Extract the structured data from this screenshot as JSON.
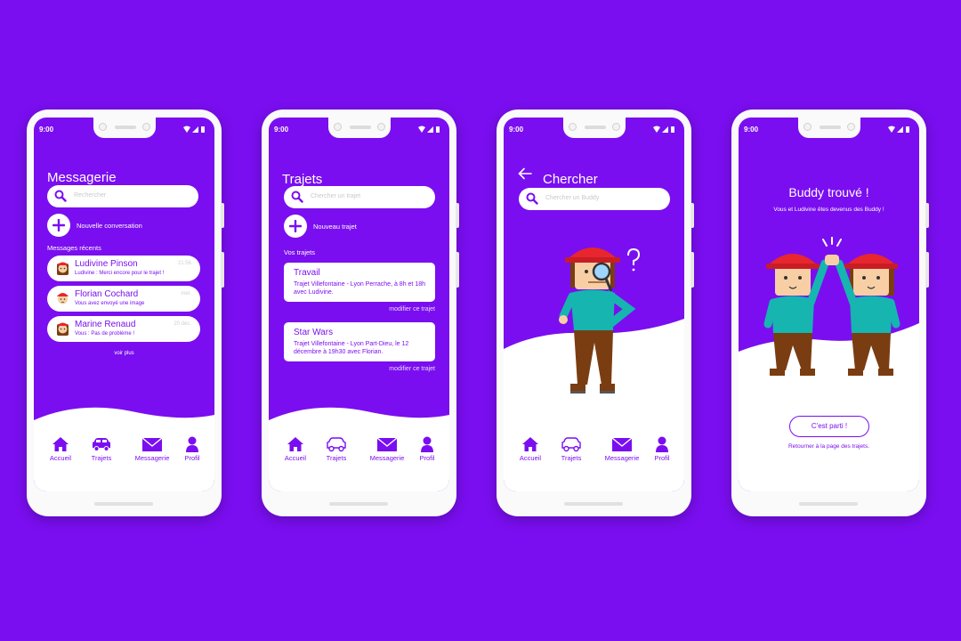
{
  "colors": {
    "brand": "#7a0ef0",
    "white": "#ffffff",
    "skin": "#f8cfa4",
    "shirt": "#16b5b0",
    "pants": "#7a3d12",
    "helmet": "#e8262e"
  },
  "status_time": "9:00",
  "nav": [
    {
      "label": "Accueil",
      "icon": "home-icon"
    },
    {
      "label": "Trajets",
      "icon": "car-icon"
    },
    {
      "label": "Messagerie",
      "icon": "mail-icon"
    },
    {
      "label": "Profil",
      "icon": "user-icon"
    }
  ],
  "screen1": {
    "title": "Messagerie",
    "search_placeholder": "Rechercher",
    "new_label": "Nouvelle conversation",
    "section": "Messages récents",
    "messages": [
      {
        "name": "Ludivine Pinson",
        "time": "21:56",
        "preview": "Ludivine : Merci encore pour le trajet !"
      },
      {
        "name": "Florian Cochard",
        "time": "mer.",
        "preview": "Vous avez envoyé une image"
      },
      {
        "name": "Marine Renaud",
        "time": "20 déc.",
        "preview": "Vous : Pas de problème !"
      }
    ],
    "more": "voir plus"
  },
  "screen2": {
    "title": "Trajets",
    "search_placeholder": "Chercher un trajet",
    "new_label": "Nouveau trajet",
    "section": "Vos trajets",
    "trips": [
      {
        "name": "Travail",
        "desc": "Trajet Villefontaine - Lyon Perrache, à 8h et 18h avec Ludivine.",
        "link": "modifier ce trajet"
      },
      {
        "name": "Star Wars",
        "desc": "Trajet Villefontaine - Lyon Part-Dieu, le 12 décembre à 19h30 avec Florian.",
        "link": "modifier ce trajet"
      }
    ]
  },
  "screen3": {
    "title": "Chercher",
    "search_placeholder": "Chercher un Buddy"
  },
  "screen4": {
    "title": "Buddy trouvé !",
    "subtitle": "Vous et Ludivine êtes devenus des Buddy !",
    "cta": "C'est parti !",
    "link": "Retourner à la page des trajets."
  }
}
